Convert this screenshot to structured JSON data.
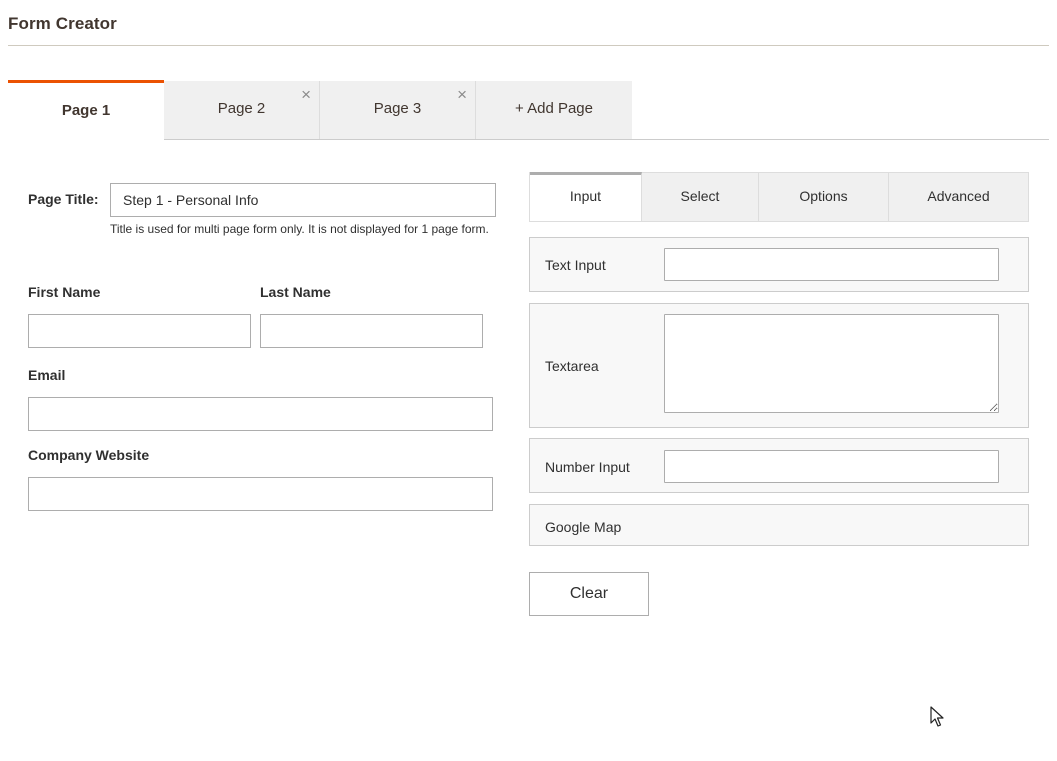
{
  "header": {
    "title": "Form Creator"
  },
  "page_tabs": [
    {
      "label": "Page 1",
      "closable": false,
      "active": true
    },
    {
      "label": "Page 2",
      "closable": true
    },
    {
      "label": "Page 3",
      "closable": true
    },
    {
      "label": "+ Add Page",
      "closable": false
    }
  ],
  "close_glyph": "×",
  "form": {
    "page_title_label": "Page Title:",
    "page_title_value": "Step 1 - Personal Info",
    "page_title_note": "Title is used for multi page form only. It is not displayed for 1 page form.",
    "first_name_label": "First Name",
    "last_name_label": "Last Name",
    "email_label": "Email",
    "website_label": "Company Website"
  },
  "field_types": {
    "tabs": [
      "Input",
      "Select",
      "Options",
      "Advanced"
    ],
    "active_tab": "Input",
    "items": {
      "text_input": "Text Input",
      "textarea": "Textarea",
      "number_input": "Number Input",
      "google_map": "Google Map"
    },
    "clear_label": "Clear"
  },
  "colors": {
    "accent": "#eb5202",
    "header_text": "#41362f"
  },
  "icons": {
    "tab_close": "close-icon",
    "pointer": "mouse-pointer-icon"
  }
}
